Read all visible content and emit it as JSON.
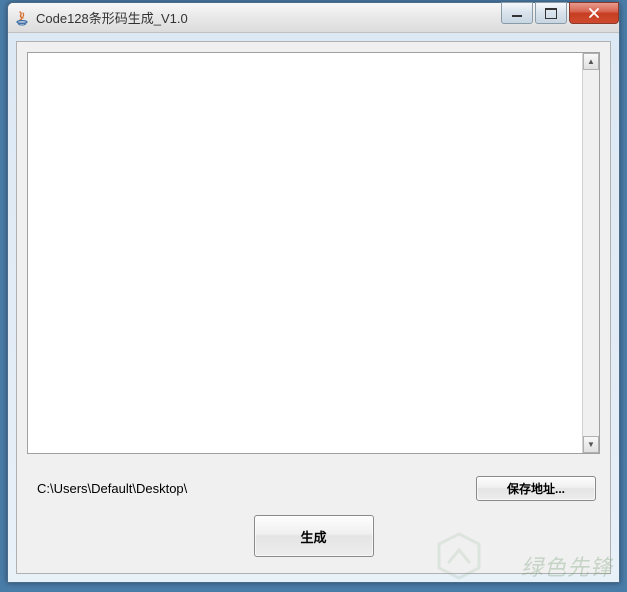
{
  "window": {
    "title": "Code128条形码生成_V1.0"
  },
  "main": {
    "textarea_value": "",
    "save_path": "C:\\Users\\Default\\Desktop\\",
    "save_button_label": "保存地址...",
    "generate_button_label": "生成"
  },
  "watermark": {
    "text": "绿色先锋"
  }
}
